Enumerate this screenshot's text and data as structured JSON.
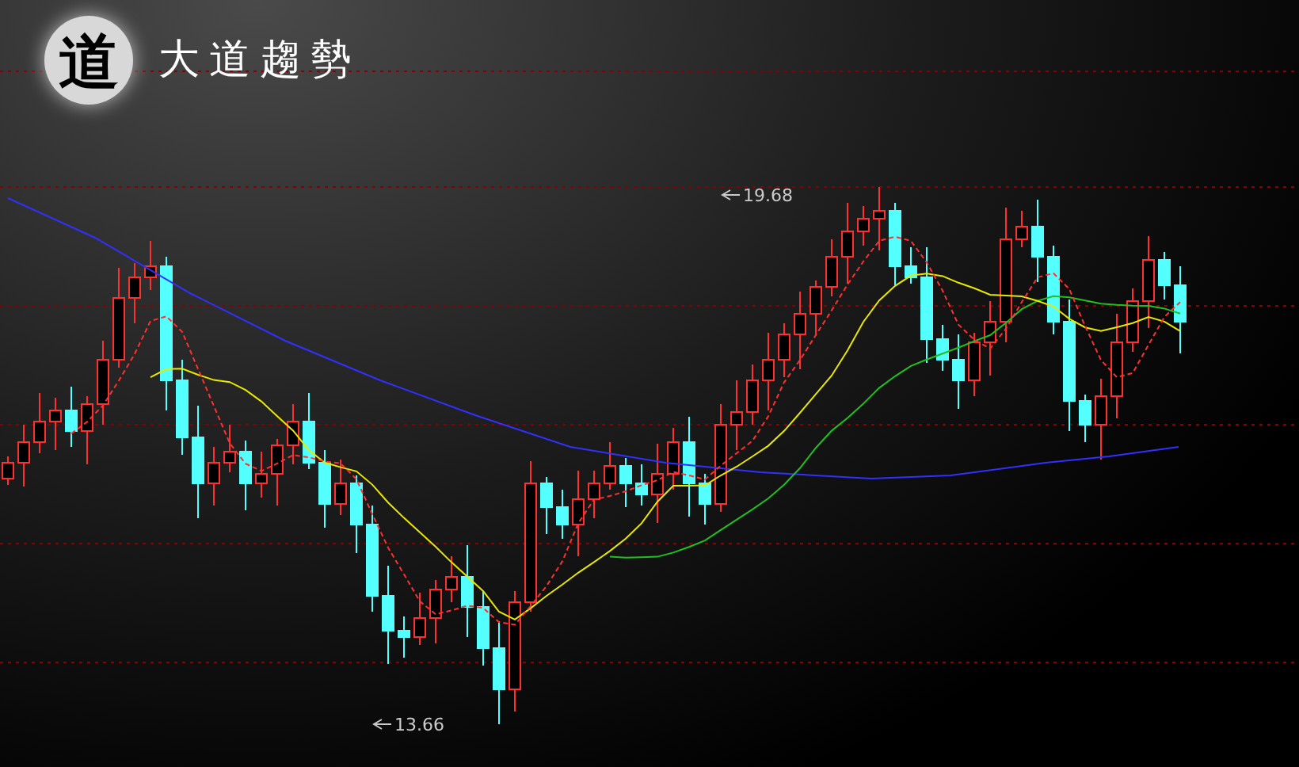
{
  "header": {
    "logo_glyph": "道",
    "title": "大道趨勢"
  },
  "chart": {
    "annotations": [
      {
        "kind": "high",
        "label": "19.68"
      },
      {
        "kind": "low",
        "label": "13.66"
      }
    ]
  }
}
